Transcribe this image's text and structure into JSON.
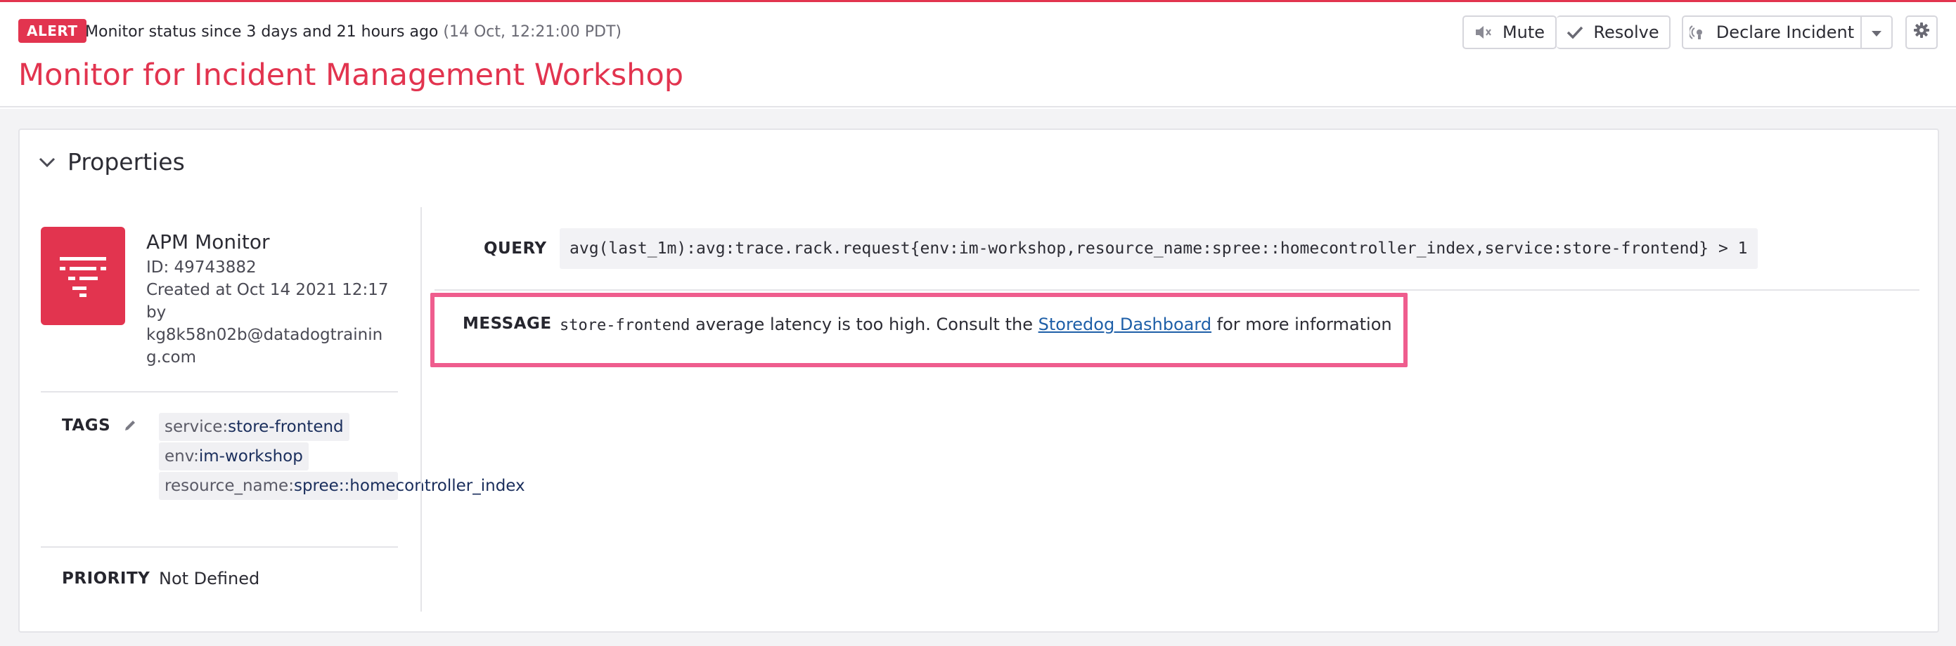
{
  "header": {
    "badge": "ALERT",
    "status_text": "Monitor status since 3 days and 21 hours ago",
    "status_timestamp": "(14 Oct, 12:21:00 PDT)",
    "title": "Monitor for Incident Management Workshop"
  },
  "toolbar": {
    "mute_label": "Mute",
    "resolve_label": "Resolve",
    "declare_label": "Declare Incident"
  },
  "properties": {
    "heading": "Properties",
    "monitor": {
      "type": "APM Monitor",
      "id": "ID: 49743882",
      "created": "Created at Oct 14 2021 12:17",
      "by": "by",
      "author": "kg8k58n02b@datadogtraining.com"
    },
    "tags_label": "TAGS",
    "tags": [
      {
        "key": "service:",
        "value": "store-frontend"
      },
      {
        "key": "env:",
        "value": "im-workshop"
      },
      {
        "key": "resource_name:",
        "value": "spree::homecontroller_index"
      }
    ],
    "priority_label": "PRIORITY",
    "priority_value": "Not Defined",
    "query_label": "QUERY",
    "query": "avg(last_1m):avg:trace.rack.request{env:im-workshop,resource_name:spree::homecontroller_index,service:store-frontend} > 1",
    "message_label": "MESSAGE",
    "message": {
      "code": "store-frontend",
      "text_before": " average latency is too high. Consult the ",
      "link": "Storedog Dashboard",
      "text_after": " for more information"
    }
  },
  "colors": {
    "alert_red": "#e2344f",
    "highlight_pink": "#ef5d8e",
    "link_blue": "#1e5fa8"
  }
}
